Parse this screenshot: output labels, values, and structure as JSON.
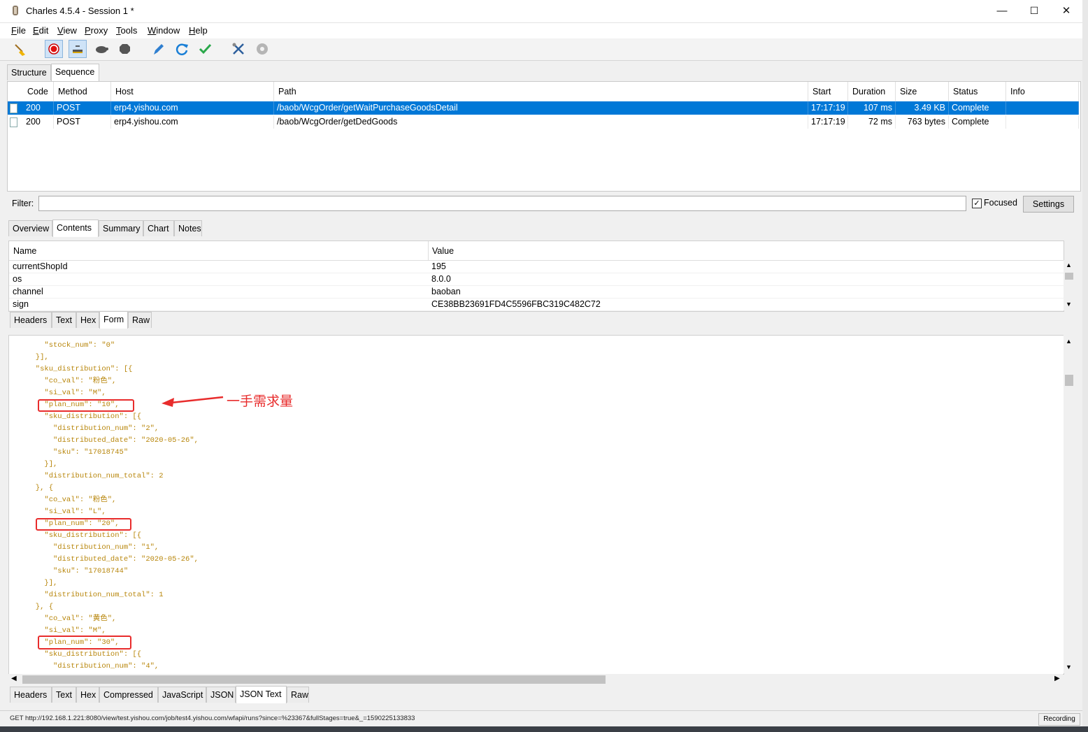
{
  "window": {
    "title": "Charles 4.5.4 - Session 1 *",
    "minimize": "—",
    "maximize": "☐",
    "close": "✕"
  },
  "menu": [
    {
      "label": "File",
      "u": "F",
      "rest": "ile"
    },
    {
      "label": "Edit",
      "u": "E",
      "rest": "dit"
    },
    {
      "label": "View",
      "u": "V",
      "rest": "iew"
    },
    {
      "label": "Proxy",
      "u": "P",
      "rest": "roxy"
    },
    {
      "label": "Tools",
      "u": "T",
      "rest": "ools"
    },
    {
      "label": "Window",
      "u": "W",
      "rest": "indow"
    },
    {
      "label": "Help",
      "u": "H",
      "rest": "elp"
    }
  ],
  "toolbar_icons": [
    "broom-icon",
    "record-icon",
    "throttle-icon",
    "turtle-icon",
    "stop-icon",
    "pen-icon",
    "refresh-icon",
    "check-icon",
    "tools-icon",
    "gear-icon"
  ],
  "top_tabs": [
    "Structure",
    "Sequence"
  ],
  "table": {
    "headers": [
      "Code",
      "Method",
      "Host",
      "Path",
      "Start",
      "Duration",
      "Size",
      "Status",
      "Info"
    ],
    "rows": [
      {
        "code": "200",
        "method": "POST",
        "host": "erp4.yishou.com",
        "path": "/baob/WcgOrder/getWaitPurchaseGoodsDetail",
        "start": "17:17:19",
        "duration": "107 ms",
        "size": "3.49 KB",
        "status": "Complete",
        "info": ""
      },
      {
        "code": "200",
        "method": "POST",
        "host": "erp4.yishou.com",
        "path": "/baob/WcgOrder/getDedGoods",
        "start": "17:17:19",
        "duration": "72 ms",
        "size": "763 bytes",
        "status": "Complete",
        "info": ""
      }
    ]
  },
  "filter": {
    "label": "Filter:",
    "value": "",
    "focused_label": "Focused",
    "focused_checked": "✓",
    "settings_label": "Settings"
  },
  "detail_tabs": [
    "Overview",
    "Contents",
    "Summary",
    "Chart",
    "Notes"
  ],
  "form_table": {
    "headers": [
      "Name",
      "Value"
    ],
    "rows": [
      {
        "name": "currentShopId",
        "value": "195"
      },
      {
        "name": "os",
        "value": "8.0.0"
      },
      {
        "name": "channel",
        "value": "baoban"
      },
      {
        "name": "sign",
        "value": "CE38BB23691FD4C5596FBC319C482C72"
      }
    ]
  },
  "request_tabs": [
    "Headers",
    "Text",
    "Hex",
    "Form",
    "Raw"
  ],
  "json_lines": [
    "        \"stock_num\": \"0\"",
    "      }],",
    "      \"sku_distribution\": [{",
    "        \"co_val\": \"粉色\",",
    "        \"si_val\": \"M\",",
    "        \"plan_num\": \"10\",",
    "        \"sku_distribution\": [{",
    "          \"distribution_num\": \"2\",",
    "          \"distributed_date\": \"2020-05-26\",",
    "          \"sku\": \"17018745\"",
    "        }],",
    "        \"distribution_num_total\": 2",
    "      }, {",
    "        \"co_val\": \"粉色\",",
    "        \"si_val\": \"L\",",
    "        \"plan_num\": \"20\",",
    "        \"sku_distribution\": [{",
    "          \"distribution_num\": \"1\",",
    "          \"distributed_date\": \"2020-05-26\",",
    "          \"sku\": \"17018744\"",
    "        }],",
    "        \"distribution_num_total\": 1",
    "      }, {",
    "        \"co_val\": \"黄色\",",
    "        \"si_val\": \"M\",",
    "        \"plan_num\": \"30\",",
    "        \"sku_distribution\": [{",
    "          \"distribution_num\": \"4\","
  ],
  "annotation": "一手需求量",
  "response_tabs": [
    "Headers",
    "Text",
    "Hex",
    "Compressed",
    "JavaScript",
    "JSON",
    "JSON Text",
    "Raw"
  ],
  "status": {
    "url": "GET http://192.168.1.221:8080/view/test.yishou.com/job/test4.yishou.com/wfapi/runs?since=%23367&fullStages=true&_=1590225133833",
    "recording": "Recording"
  },
  "colors": {
    "selection": "#0078d7",
    "annotation": "#e82c2c",
    "json_text": "#b8860b"
  }
}
